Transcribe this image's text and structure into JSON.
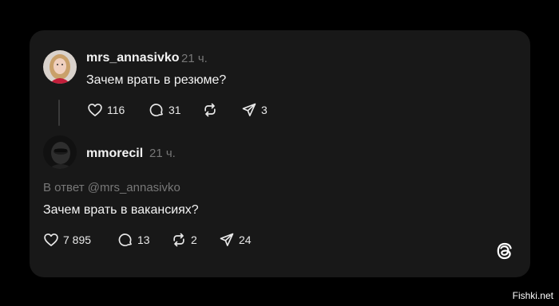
{
  "post": {
    "username": "mrs_annasivko",
    "time": "21 ч.",
    "text": "Зачем врать в резюме?",
    "likes": "116",
    "comments": "31",
    "shares": "3"
  },
  "reply": {
    "username": "mmorecil",
    "time": "21 ч.",
    "reply_to": "В ответ @mrs_annasivko",
    "text": "Зачем врать в вакансиях?",
    "likes": "7 895",
    "comments": "13",
    "reposts": "2",
    "shares": "24"
  },
  "watermark": "Fishki.net",
  "icons": {
    "like": "heart-icon",
    "comment": "comment-icon",
    "repost": "repost-icon",
    "share": "share-icon",
    "app": "threads-logo-icon"
  },
  "colors": {
    "background": "#000000",
    "card": "#181818",
    "text": "#f3f3f3",
    "muted": "#777777"
  }
}
